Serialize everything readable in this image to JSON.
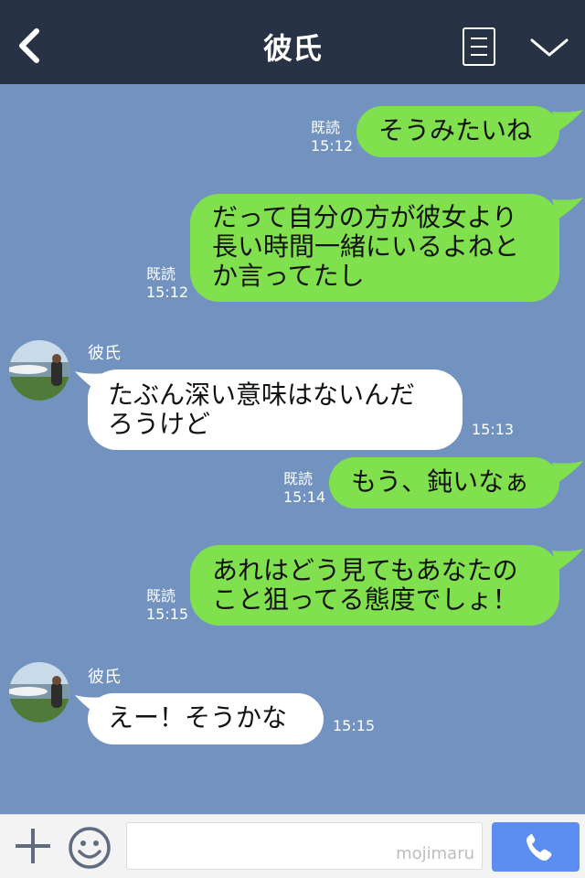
{
  "header": {
    "title": "彼氏",
    "back_icon": "chevron-left-icon",
    "menu_icon": "menu-list-icon",
    "expand_icon": "chevron-down-icon"
  },
  "messages": [
    {
      "side": "me",
      "lines": [
        "そうみたいね"
      ],
      "read": "既読",
      "time": "15:12"
    },
    {
      "side": "me",
      "lines": [
        "だって自分の方が彼女より",
        "長い時間一緒にいるよねと",
        "か言ってたし"
      ],
      "read": "既読",
      "time": "15:12"
    },
    {
      "side": "them",
      "sender": "彼氏",
      "lines": [
        "たぶん深い意味はないんだ",
        "ろうけど"
      ],
      "time": "15:13"
    },
    {
      "side": "me",
      "lines": [
        "もう、鈍いなぁ"
      ],
      "read": "既読",
      "time": "15:14"
    },
    {
      "side": "me",
      "lines": [
        "あれはどう見てもあなたの",
        "こと狙ってる態度でしょ！"
      ],
      "read": "既読",
      "time": "15:15"
    },
    {
      "side": "them",
      "sender": "彼氏",
      "lines": [
        "えー！そうかな"
      ],
      "time": "15:15"
    }
  ],
  "bottom": {
    "watermark": "mojimaru",
    "plus_icon": "plus-icon",
    "emoji_icon": "smiley-icon",
    "call_icon": "phone-icon"
  },
  "colors": {
    "background": "#7293c0",
    "header": "#273245",
    "my_bubble": "#80e04d",
    "their_bubble": "#ffffff",
    "call_button": "#5b8ef0"
  }
}
